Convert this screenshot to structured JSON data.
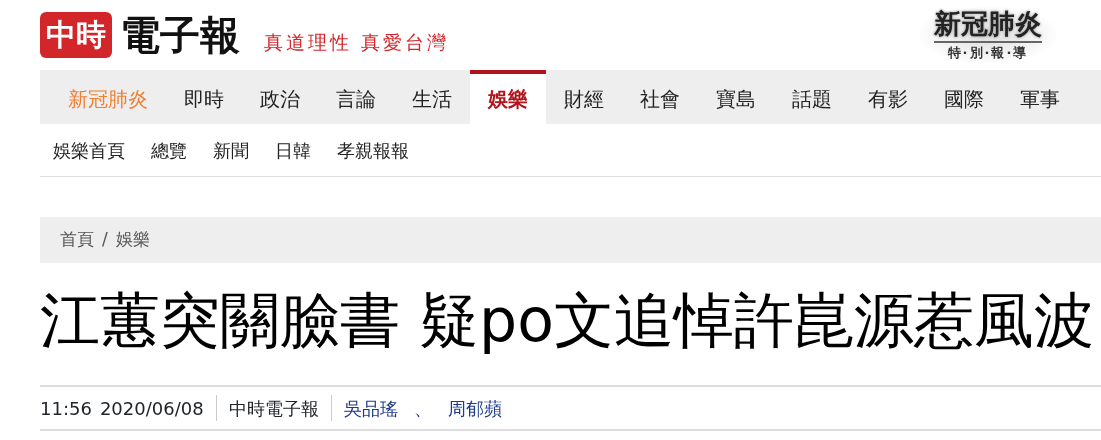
{
  "header": {
    "logo_badge": "中時",
    "logo_text": "電子報",
    "slogan": "真道理性 真愛台灣",
    "banner": {
      "title": "新冠肺炎",
      "subtitle": "特·別·報·導"
    }
  },
  "nav": [
    {
      "label": "新冠肺炎",
      "kind": "featured",
      "selected": false
    },
    {
      "label": "即時",
      "kind": "normal",
      "selected": false
    },
    {
      "label": "政治",
      "kind": "normal",
      "selected": false
    },
    {
      "label": "言論",
      "kind": "normal",
      "selected": false
    },
    {
      "label": "生活",
      "kind": "normal",
      "selected": false
    },
    {
      "label": "娛樂",
      "kind": "normal",
      "selected": true
    },
    {
      "label": "財經",
      "kind": "normal",
      "selected": false
    },
    {
      "label": "社會",
      "kind": "normal",
      "selected": false
    },
    {
      "label": "寶島",
      "kind": "normal",
      "selected": false
    },
    {
      "label": "話題",
      "kind": "normal",
      "selected": false
    },
    {
      "label": "有影",
      "kind": "normal",
      "selected": false
    },
    {
      "label": "國際",
      "kind": "normal",
      "selected": false
    },
    {
      "label": "軍事",
      "kind": "normal",
      "selected": false
    }
  ],
  "subnav": [
    "娛樂首頁",
    "總覽",
    "新聞",
    "日韓",
    "孝親報報"
  ],
  "breadcrumb": [
    "首頁",
    "娛樂"
  ],
  "breadcrumb_divider": "/",
  "headline": "江蕙突關臉書 疑po文追悼許崑源惹風波",
  "meta": {
    "time": "11:56",
    "date": "2020/06/08",
    "source": "中時電子報",
    "authors": [
      "吳品瑤",
      "周郁蘋"
    ],
    "author_separator": "、"
  }
}
